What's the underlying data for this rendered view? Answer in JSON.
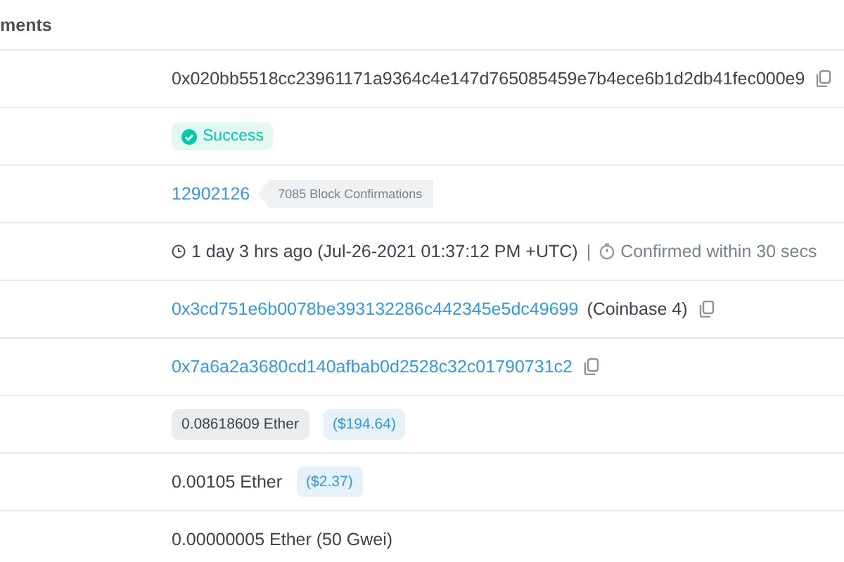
{
  "tab": {
    "label": "ments"
  },
  "rows": [
    {
      "kind": "hash",
      "text": "0x020bb5518cc23961171a9364c4e147d765085459e7b4ece6b1d2db41fec000e9"
    },
    {
      "kind": "status",
      "text": "Success"
    },
    {
      "kind": "block",
      "link": "12902126",
      "badge": "7085 Block Confirmations"
    },
    {
      "kind": "time",
      "text": "1 day 3 hrs ago (Jul-26-2021 01:37:12 PM +UTC)",
      "separator": "|",
      "note": "Confirmed within 30 secs"
    },
    {
      "kind": "address",
      "link": "0x3cd751e6b0078be393132286c442345e5dc49699",
      "name": "(Coinbase 4)"
    },
    {
      "kind": "address",
      "link": "0x7a6a2a3680cd140afbab0d2528c32c01790731c2"
    },
    {
      "kind": "value",
      "badge": "0.08618609 Ether",
      "usd": "($194.64)"
    },
    {
      "kind": "fee",
      "text": "0.00105 Ether",
      "usd": "($2.37)"
    },
    {
      "kind": "plain",
      "text": "0.00000005 Ether (50 Gwei)"
    }
  ]
}
